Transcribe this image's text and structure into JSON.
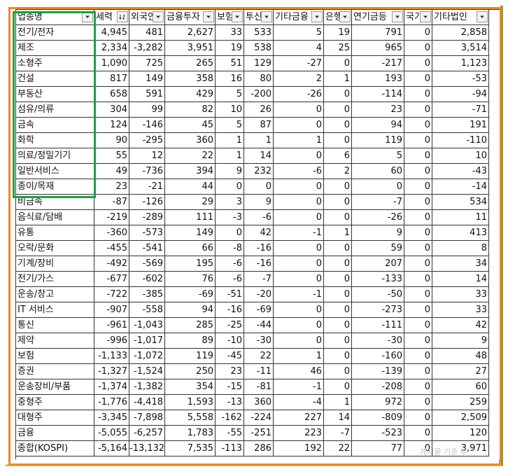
{
  "columns": [
    "업종명",
    "세력",
    "외국인",
    "금융투자",
    "보험",
    "투신",
    "기타금융",
    "은행",
    "연기금등",
    "국가",
    "기타법인"
  ],
  "sort_column_index": 1,
  "rows": [
    {
      "name": "전기/전자",
      "v": [
        "4,945",
        "481",
        "2,627",
        "33",
        "533",
        "5",
        "19",
        "791",
        "0",
        "2,858"
      ]
    },
    {
      "name": "제조",
      "v": [
        "2,334",
        "-3,282",
        "3,951",
        "19",
        "538",
        "4",
        "25",
        "965",
        "0",
        "3,514"
      ]
    },
    {
      "name": "소형주",
      "v": [
        "1,090",
        "725",
        "265",
        "51",
        "129",
        "-27",
        "0",
        "-217",
        "0",
        "1,123"
      ]
    },
    {
      "name": "건설",
      "v": [
        "817",
        "149",
        "358",
        "16",
        "80",
        "2",
        "1",
        "193",
        "0",
        "-53"
      ]
    },
    {
      "name": "부동산",
      "v": [
        "658",
        "591",
        "429",
        "5",
        "-200",
        "-26",
        "0",
        "-114",
        "0",
        "-94"
      ]
    },
    {
      "name": "섬유/의류",
      "v": [
        "304",
        "99",
        "82",
        "10",
        "26",
        "0",
        "0",
        "23",
        "0",
        "-71"
      ]
    },
    {
      "name": "금속",
      "v": [
        "124",
        "-146",
        "45",
        "5",
        "87",
        "0",
        "0",
        "94",
        "0",
        "191"
      ]
    },
    {
      "name": "화학",
      "v": [
        "90",
        "-295",
        "360",
        "1",
        "1",
        "1",
        "0",
        "119",
        "0",
        "-110"
      ]
    },
    {
      "name": "의료/정밀기기",
      "v": [
        "55",
        "12",
        "22",
        "1",
        "14",
        "0",
        "6",
        "5",
        "0",
        "10"
      ]
    },
    {
      "name": "일반서비스",
      "v": [
        "49",
        "-736",
        "394",
        "9",
        "232",
        "-6",
        "2",
        "60",
        "0",
        "-43"
      ]
    },
    {
      "name": "종이/목재",
      "v": [
        "23",
        "-21",
        "44",
        "0",
        "0",
        "0",
        "0",
        "0",
        "0",
        "-14"
      ]
    },
    {
      "name": "비금속",
      "v": [
        "-87",
        "-126",
        "29",
        "3",
        "9",
        "0",
        "0",
        "-7",
        "0",
        "534"
      ]
    },
    {
      "name": "음식료/담배",
      "v": [
        "-219",
        "-289",
        "111",
        "-3",
        "-6",
        "0",
        "0",
        "-26",
        "0",
        "11"
      ]
    },
    {
      "name": "유통",
      "v": [
        "-360",
        "-573",
        "149",
        "0",
        "42",
        "-1",
        "1",
        "9",
        "0",
        "413"
      ]
    },
    {
      "name": "오락/문화",
      "v": [
        "-455",
        "-541",
        "66",
        "-8",
        "-16",
        "0",
        "0",
        "59",
        "0",
        "8"
      ]
    },
    {
      "name": "기계/장비",
      "v": [
        "-492",
        "-569",
        "195",
        "-6",
        "-16",
        "0",
        "0",
        "207",
        "0",
        "34"
      ]
    },
    {
      "name": "전기/가스",
      "v": [
        "-677",
        "-602",
        "76",
        "-6",
        "-7",
        "0",
        "0",
        "-133",
        "0",
        "14"
      ]
    },
    {
      "name": "운송/창고",
      "v": [
        "-722",
        "-385",
        "-69",
        "-51",
        "-20",
        "-1",
        "0",
        "-50",
        "0",
        "33"
      ]
    },
    {
      "name": "IT 서비스",
      "v": [
        "-907",
        "-558",
        "94",
        "-16",
        "-69",
        "0",
        "0",
        "-273",
        "0",
        "33"
      ]
    },
    {
      "name": "통신",
      "v": [
        "-961",
        "-1,043",
        "285",
        "-25",
        "-44",
        "0",
        "0",
        "-111",
        "0",
        "42"
      ]
    },
    {
      "name": "제약",
      "v": [
        "-996",
        "-1,017",
        "89",
        "-10",
        "-30",
        "0",
        "0",
        "-30",
        "0",
        "9"
      ]
    },
    {
      "name": "보험",
      "v": [
        "-1,133",
        "-1,072",
        "119",
        "-45",
        "22",
        "1",
        "0",
        "-160",
        "0",
        "48"
      ]
    },
    {
      "name": "증권",
      "v": [
        "-1,327",
        "-1,524",
        "250",
        "23",
        "-11",
        "46",
        "0",
        "-139",
        "0",
        "27"
      ]
    },
    {
      "name": "운송장비/부품",
      "v": [
        "-1,374",
        "-1,382",
        "354",
        "-15",
        "-81",
        "-1",
        "0",
        "-208",
        "0",
        "60"
      ]
    },
    {
      "name": "중형주",
      "v": [
        "-1,776",
        "-4,418",
        "1,593",
        "-13",
        "360",
        "-4",
        "1",
        "972",
        "0",
        "259"
      ]
    },
    {
      "name": "대형주",
      "v": [
        "-3,345",
        "-7,898",
        "5,558",
        "-162",
        "-224",
        "227",
        "14",
        "-809",
        "0",
        "2,509"
      ]
    },
    {
      "name": "금융",
      "v": [
        "-5,055",
        "-6,257",
        "1,783",
        "-55",
        "-251",
        "223",
        "-7",
        "-523",
        "0",
        "120"
      ]
    },
    {
      "name": "종합(KOSPI)",
      "v": [
        "-5,164",
        "-13,132",
        "7,535",
        "-113",
        "286",
        "192",
        "22",
        "77",
        "0",
        "3,971"
      ]
    }
  ],
  "watermark": "게시물 기준 추"
}
